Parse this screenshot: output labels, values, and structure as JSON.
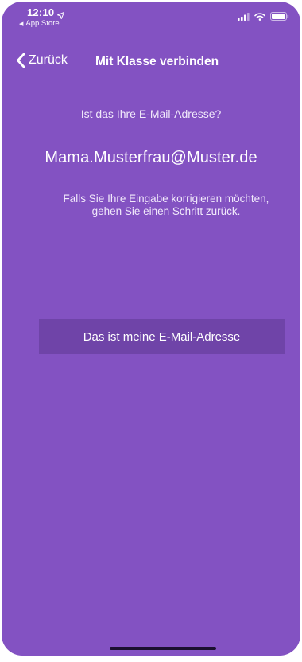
{
  "status_bar": {
    "time": "12:10",
    "back_app_label": "App Store"
  },
  "nav": {
    "back_label": "Zurück",
    "title": "Mit Klasse verbinden"
  },
  "content": {
    "question": "Ist das Ihre E-Mail-Adresse?",
    "email": "Mama.Musterfrau@Muster.de",
    "hint": "Falls Sie Ihre Eingabe korrigieren möchten, gehen Sie einen Schritt zurück."
  },
  "actions": {
    "confirm_label": "Das ist meine E-Mail-Adresse"
  },
  "colors": {
    "background": "#8352c2",
    "button": "#6f44a8",
    "text": "#ffffff"
  },
  "icons": {
    "location": "location-arrow-icon",
    "signal": "cellular-signal-icon",
    "wifi": "wifi-icon",
    "battery": "battery-icon",
    "back": "chevron-left-icon"
  }
}
